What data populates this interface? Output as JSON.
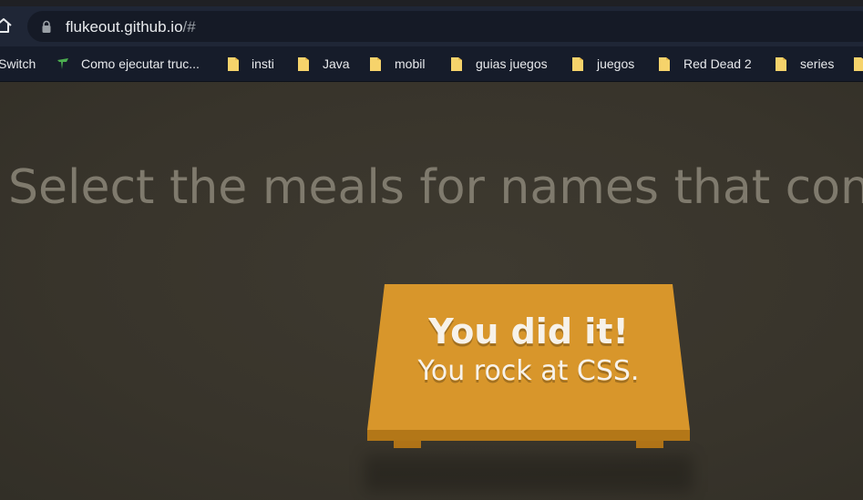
{
  "browser": {
    "url_host": "flukeout.github.io",
    "url_path": "/#",
    "bookmarks": [
      {
        "label": "Switch",
        "icon": "none"
      },
      {
        "label": "Como ejecutar truc...",
        "icon": "site-icon"
      },
      {
        "label": "insti",
        "icon": "folder-icon"
      },
      {
        "label": "Java",
        "icon": "folder-icon"
      },
      {
        "label": "mobil",
        "icon": "folder-icon"
      },
      {
        "label": "guias juegos",
        "icon": "folder-icon"
      },
      {
        "label": "juegos",
        "icon": "folder-icon"
      },
      {
        "label": "Red Dead 2",
        "icon": "folder-icon"
      },
      {
        "label": "series",
        "icon": "folder-icon"
      }
    ]
  },
  "game": {
    "instruction": "Select the meals for names that conte",
    "win_title": "You did it!",
    "win_subtitle": "You rock at CSS."
  },
  "colors": {
    "background": "#3b372d",
    "table": "#d6952a",
    "instruction_text": "#7f7a6d",
    "chrome": "#1f2636"
  }
}
